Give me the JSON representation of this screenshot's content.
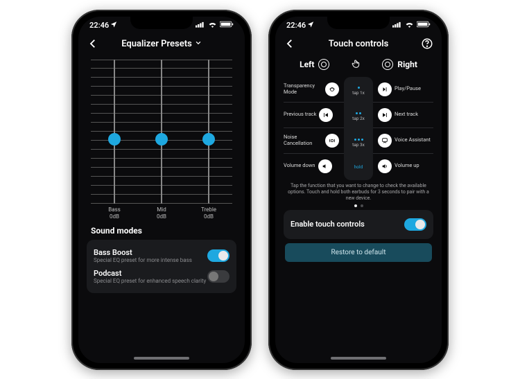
{
  "status": {
    "time": "22:46"
  },
  "phone1": {
    "title": "Equalizer Presets",
    "eq": {
      "bands": [
        {
          "name": "Bass",
          "value_db": 0,
          "label": "0dB",
          "knob_pct": 50
        },
        {
          "name": "Mid",
          "value_db": 0,
          "label": "0dB",
          "knob_pct": 50
        },
        {
          "name": "Treble",
          "value_db": 0,
          "label": "0dB",
          "knob_pct": 50
        }
      ]
    },
    "sound_modes": {
      "title": "Sound modes",
      "items": [
        {
          "name": "Bass Boost",
          "subtitle": "Special EQ preset for more intense bass",
          "on": true
        },
        {
          "name": "Podcast",
          "subtitle": "Special EQ preset for enhanced speech clarity",
          "on": false
        }
      ]
    }
  },
  "phone2": {
    "title": "Touch controls",
    "left_label": "Left",
    "right_label": "Right",
    "rows": [
      {
        "left": "Transparency Mode",
        "left_icon": "transparency",
        "center": "tap 1x",
        "dots": 1,
        "right": "Play/Pause",
        "right_icon": "playpause"
      },
      {
        "left": "Previous track",
        "left_icon": "prev",
        "center": "tap 2x",
        "dots": 2,
        "right": "Next track",
        "right_icon": "next"
      },
      {
        "left": "Noise Cancellation",
        "left_icon": "anc",
        "center": "tap 3x",
        "dots": 3,
        "right": "Voice Assistant",
        "right_icon": "voice"
      },
      {
        "left": "Volume down",
        "left_icon": "voldown",
        "center": "hold",
        "dots": 0,
        "right": "Volume up",
        "right_icon": "volup"
      }
    ],
    "hint": "Tap the function that you want to change to check the available options. Touch and hold both earbuds for 3 seconds to pair with a new device.",
    "enable_touch": {
      "label": "Enable touch controls",
      "on": true
    },
    "restore": "Restore to default"
  }
}
